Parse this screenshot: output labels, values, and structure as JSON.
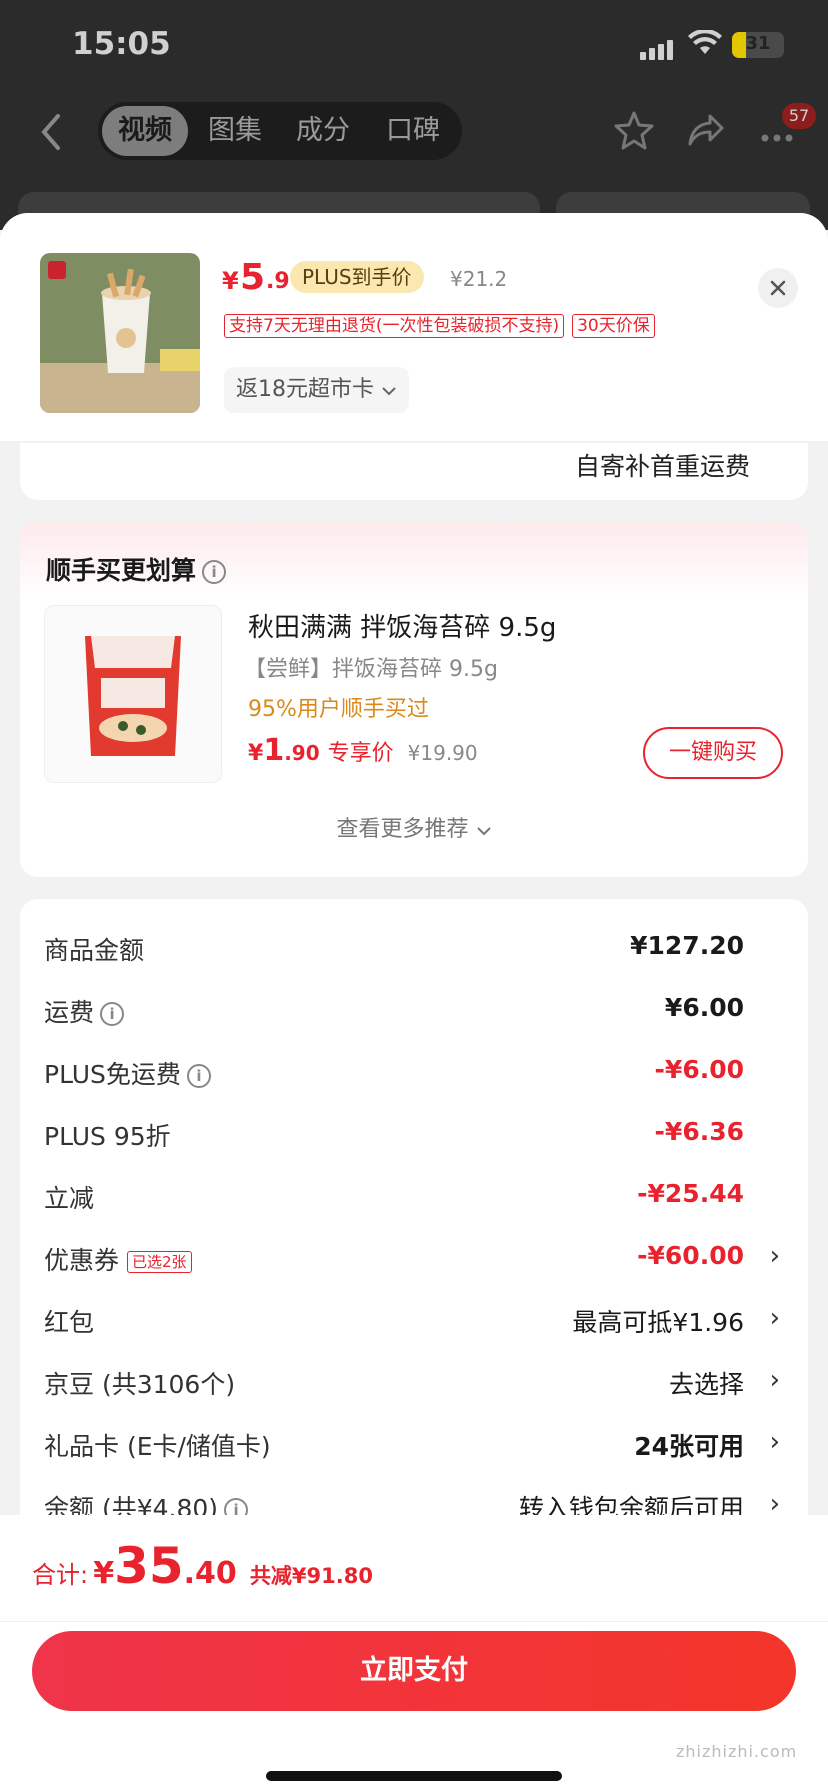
{
  "status_bar": {
    "time": "15:05",
    "battery": "31"
  },
  "nav": {
    "tabs": [
      {
        "label": "视频",
        "active": true
      },
      {
        "label": "图集",
        "active": false
      },
      {
        "label": "成分",
        "active": false
      },
      {
        "label": "口碑",
        "active": false
      }
    ],
    "cart_badge": "57"
  },
  "product": {
    "price_symbol": "¥",
    "price_int": "5",
    "price_dec": ".9",
    "plus_tag": "PLUS到手价",
    "original_price": "¥21.2",
    "promo_tags": [
      "支持7天无理由退货(一次性包装破损不支持)",
      "30天价保"
    ],
    "rebate": "返18元超市卡"
  },
  "shipping_note": "自寄补首重运费",
  "recommend": {
    "title": "顺手买更划算",
    "item": {
      "name": "秋田满满 拌饭海苔碎 9.5g",
      "subtitle": "【尝鲜】拌饭海苔碎 9.5g",
      "users_note": "95%用户顺手买过",
      "price_symbol": "¥",
      "price_int": "1",
      "price_dec": ".90",
      "price_tag": "专享价",
      "original_price": "¥19.90",
      "buy_label": "一键购买"
    },
    "more_label": "查看更多推荐"
  },
  "summary": {
    "rows": [
      {
        "label": "商品金额",
        "value": "¥127.20"
      },
      {
        "label": "运费",
        "value": "¥6.00"
      },
      {
        "label": "PLUS免运费",
        "value": "-¥6.00"
      },
      {
        "label": "PLUS 95折",
        "value": "-¥6.36"
      },
      {
        "label": "立减",
        "value": "-¥25.44"
      },
      {
        "label": "优惠券",
        "value": "-¥60.00",
        "tag": "已选2张"
      },
      {
        "label": "红包",
        "value": "最高可抵¥1.96"
      },
      {
        "label": "京豆 (共3106个)",
        "value": "去选择"
      },
      {
        "label": "礼品卡 (E卡/储值卡)",
        "value": "24张可用"
      },
      {
        "label": "余额 (共¥4.80)",
        "value": "转入钱包余额后可用"
      }
    ]
  },
  "footer": {
    "total_label": "合计:",
    "total_symbol": "¥",
    "total_int": "35",
    "total_dec": ".40",
    "total_saved": "共减¥91.80",
    "pay_label": "立即支付"
  },
  "watermark": "zhizhizhi.com",
  "colors": {
    "accent": "#e8232e",
    "plus_gold": "#fbe8b0",
    "users_note": "#d98a1a"
  }
}
